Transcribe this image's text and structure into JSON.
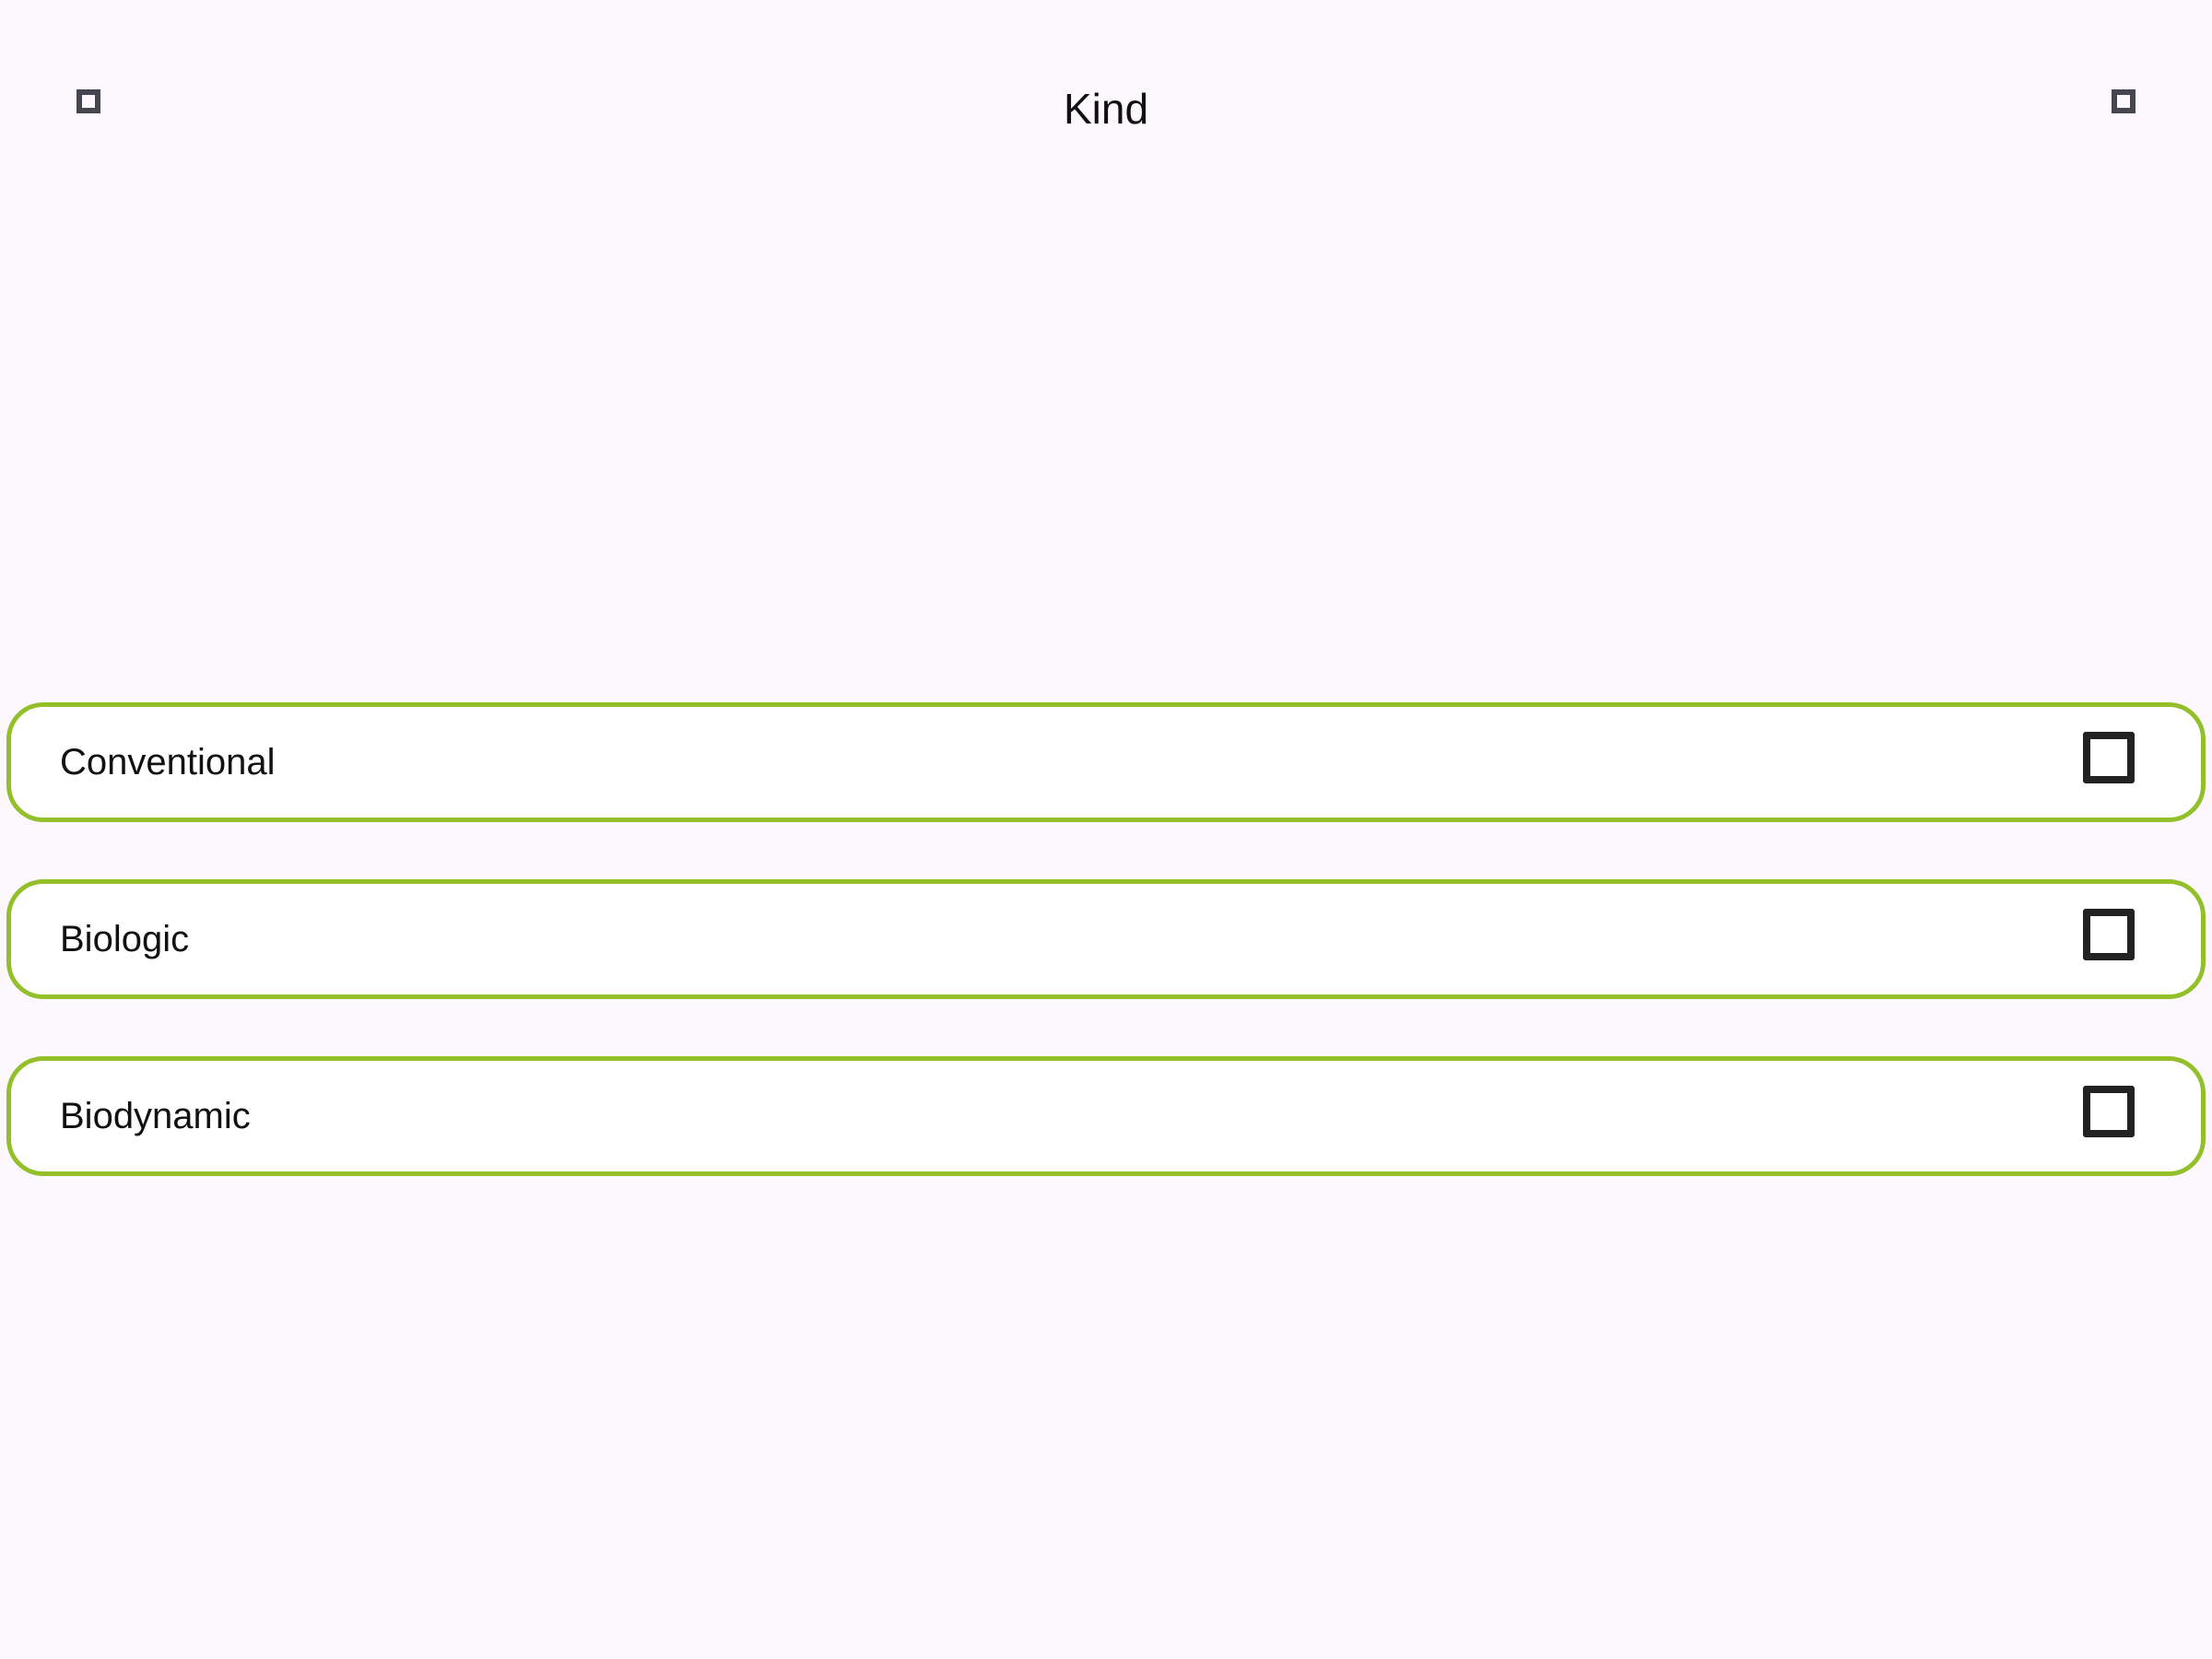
{
  "header": {
    "title": "Kind",
    "left_icon": "square-outline-icon",
    "right_icon": "square-outline-icon"
  },
  "options": [
    {
      "label": "Conventional",
      "checked": false
    },
    {
      "label": "Biologic",
      "checked": false
    },
    {
      "label": "Biodynamic",
      "checked": false
    }
  ],
  "colors": {
    "background": "#fdf8fd",
    "accent_border": "#93c02a",
    "checkbox": "#222222",
    "icon": "#45464f"
  }
}
